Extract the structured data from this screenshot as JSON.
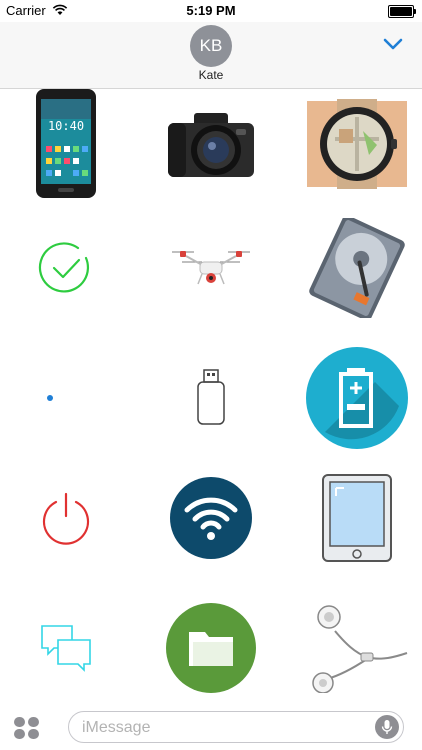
{
  "status_bar": {
    "carrier": "Carrier",
    "time": "5:19 PM"
  },
  "header": {
    "avatar_initials": "KB",
    "contact_name": "Kate"
  },
  "stickers": [
    {
      "name": "smartphone-sticker"
    },
    {
      "name": "dslr-camera-sticker"
    },
    {
      "name": "smartwatch-map-sticker"
    },
    {
      "name": "green-checkmark-sticker"
    },
    {
      "name": "drone-sticker"
    },
    {
      "name": "hard-drive-sticker"
    },
    {
      "name": "blue-dot-sticker"
    },
    {
      "name": "usb-flash-drive-sticker"
    },
    {
      "name": "battery-circle-sticker"
    },
    {
      "name": "power-button-sticker"
    },
    {
      "name": "wifi-circle-sticker"
    },
    {
      "name": "tablet-sticker"
    },
    {
      "name": "chat-bubbles-sticker"
    },
    {
      "name": "folder-circle-sticker"
    },
    {
      "name": "earphones-sticker"
    }
  ],
  "input": {
    "placeholder": "iMessage"
  },
  "colors": {
    "accent": "#1f7fd6",
    "avatar": "#8e9198",
    "check": "#2ecc40",
    "power": "#e03131",
    "wifi": "#0d4a6b",
    "folder": "#5a9a3a",
    "battery": "#1eaecf"
  }
}
